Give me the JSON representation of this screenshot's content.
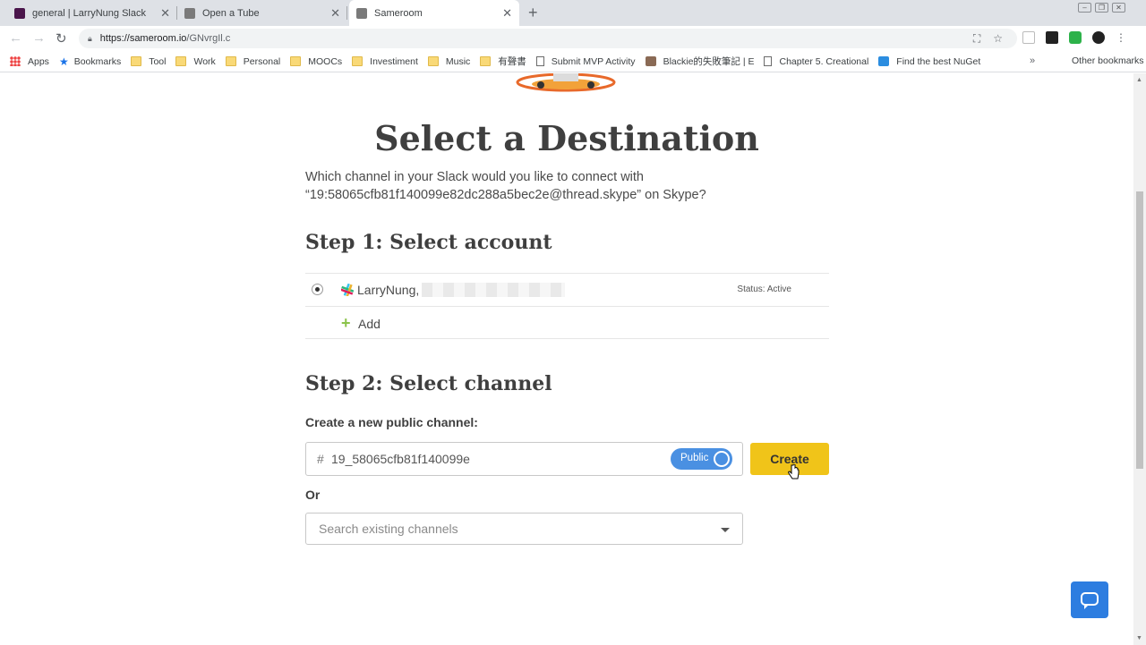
{
  "browser": {
    "tabs": [
      {
        "title": "general | LarryNung Slack",
        "favicon_color": "#4a154b"
      },
      {
        "title": "Open a Tube",
        "favicon_color": "#7a7a7a"
      },
      {
        "title": "Sameroom",
        "favicon_color": "#7a7a7a",
        "active": true
      }
    ],
    "new_tab_icon": "+",
    "url_host": "https://sameroom.io",
    "url_path": "/GNvrgIl.c",
    "bookmarks": [
      {
        "label": "Apps",
        "icon": "apps-grid-icon"
      },
      {
        "label": "Bookmarks",
        "icon": "star-icon"
      },
      {
        "label": "Tool",
        "icon": "folder-icon"
      },
      {
        "label": "Work",
        "icon": "folder-icon"
      },
      {
        "label": "Personal",
        "icon": "folder-icon"
      },
      {
        "label": "MOOCs",
        "icon": "folder-icon"
      },
      {
        "label": "Investiment",
        "icon": "folder-icon"
      },
      {
        "label": "Music",
        "icon": "folder-icon"
      },
      {
        "label": "有聲書",
        "icon": "folder-icon"
      },
      {
        "label": "Submit MVP Activity",
        "icon": "page-icon"
      },
      {
        "label": "Blackie的失敗筆記 | E",
        "icon": "avatar-icon"
      },
      {
        "label": "Chapter 5. Creational",
        "icon": "page-icon"
      },
      {
        "label": "Find the best NuGet",
        "icon": "nuget-icon"
      }
    ],
    "bookmarks_overflow": "»",
    "other_bookmarks": "Other bookmarks"
  },
  "page": {
    "heading": "Select a Destination",
    "intro_line1": "Which channel in your Slack would you like to connect with",
    "intro_line2": "“19:58065cfb81f140099e82dc288a5bec2e@thread.skype” on Skype?",
    "step1": {
      "title": "Step 1: Select account",
      "account_name": "LarryNung,",
      "account_status": "Status: Active",
      "add_label": "Add"
    },
    "step2": {
      "title": "Step 2: Select channel",
      "create_label": "Create a new public channel:",
      "hash_symbol": "#",
      "channel_name_value": "19_58065cfb81f140099e",
      "visibility_toggle": "Public",
      "create_button": "Create",
      "or_label": "Or",
      "search_placeholder": "Search existing channels"
    }
  },
  "colors": {
    "create_button": "#f0c419",
    "toggle": "#4a90e2",
    "chat_button": "#2d7de0",
    "add_plus": "#8bc34a"
  }
}
